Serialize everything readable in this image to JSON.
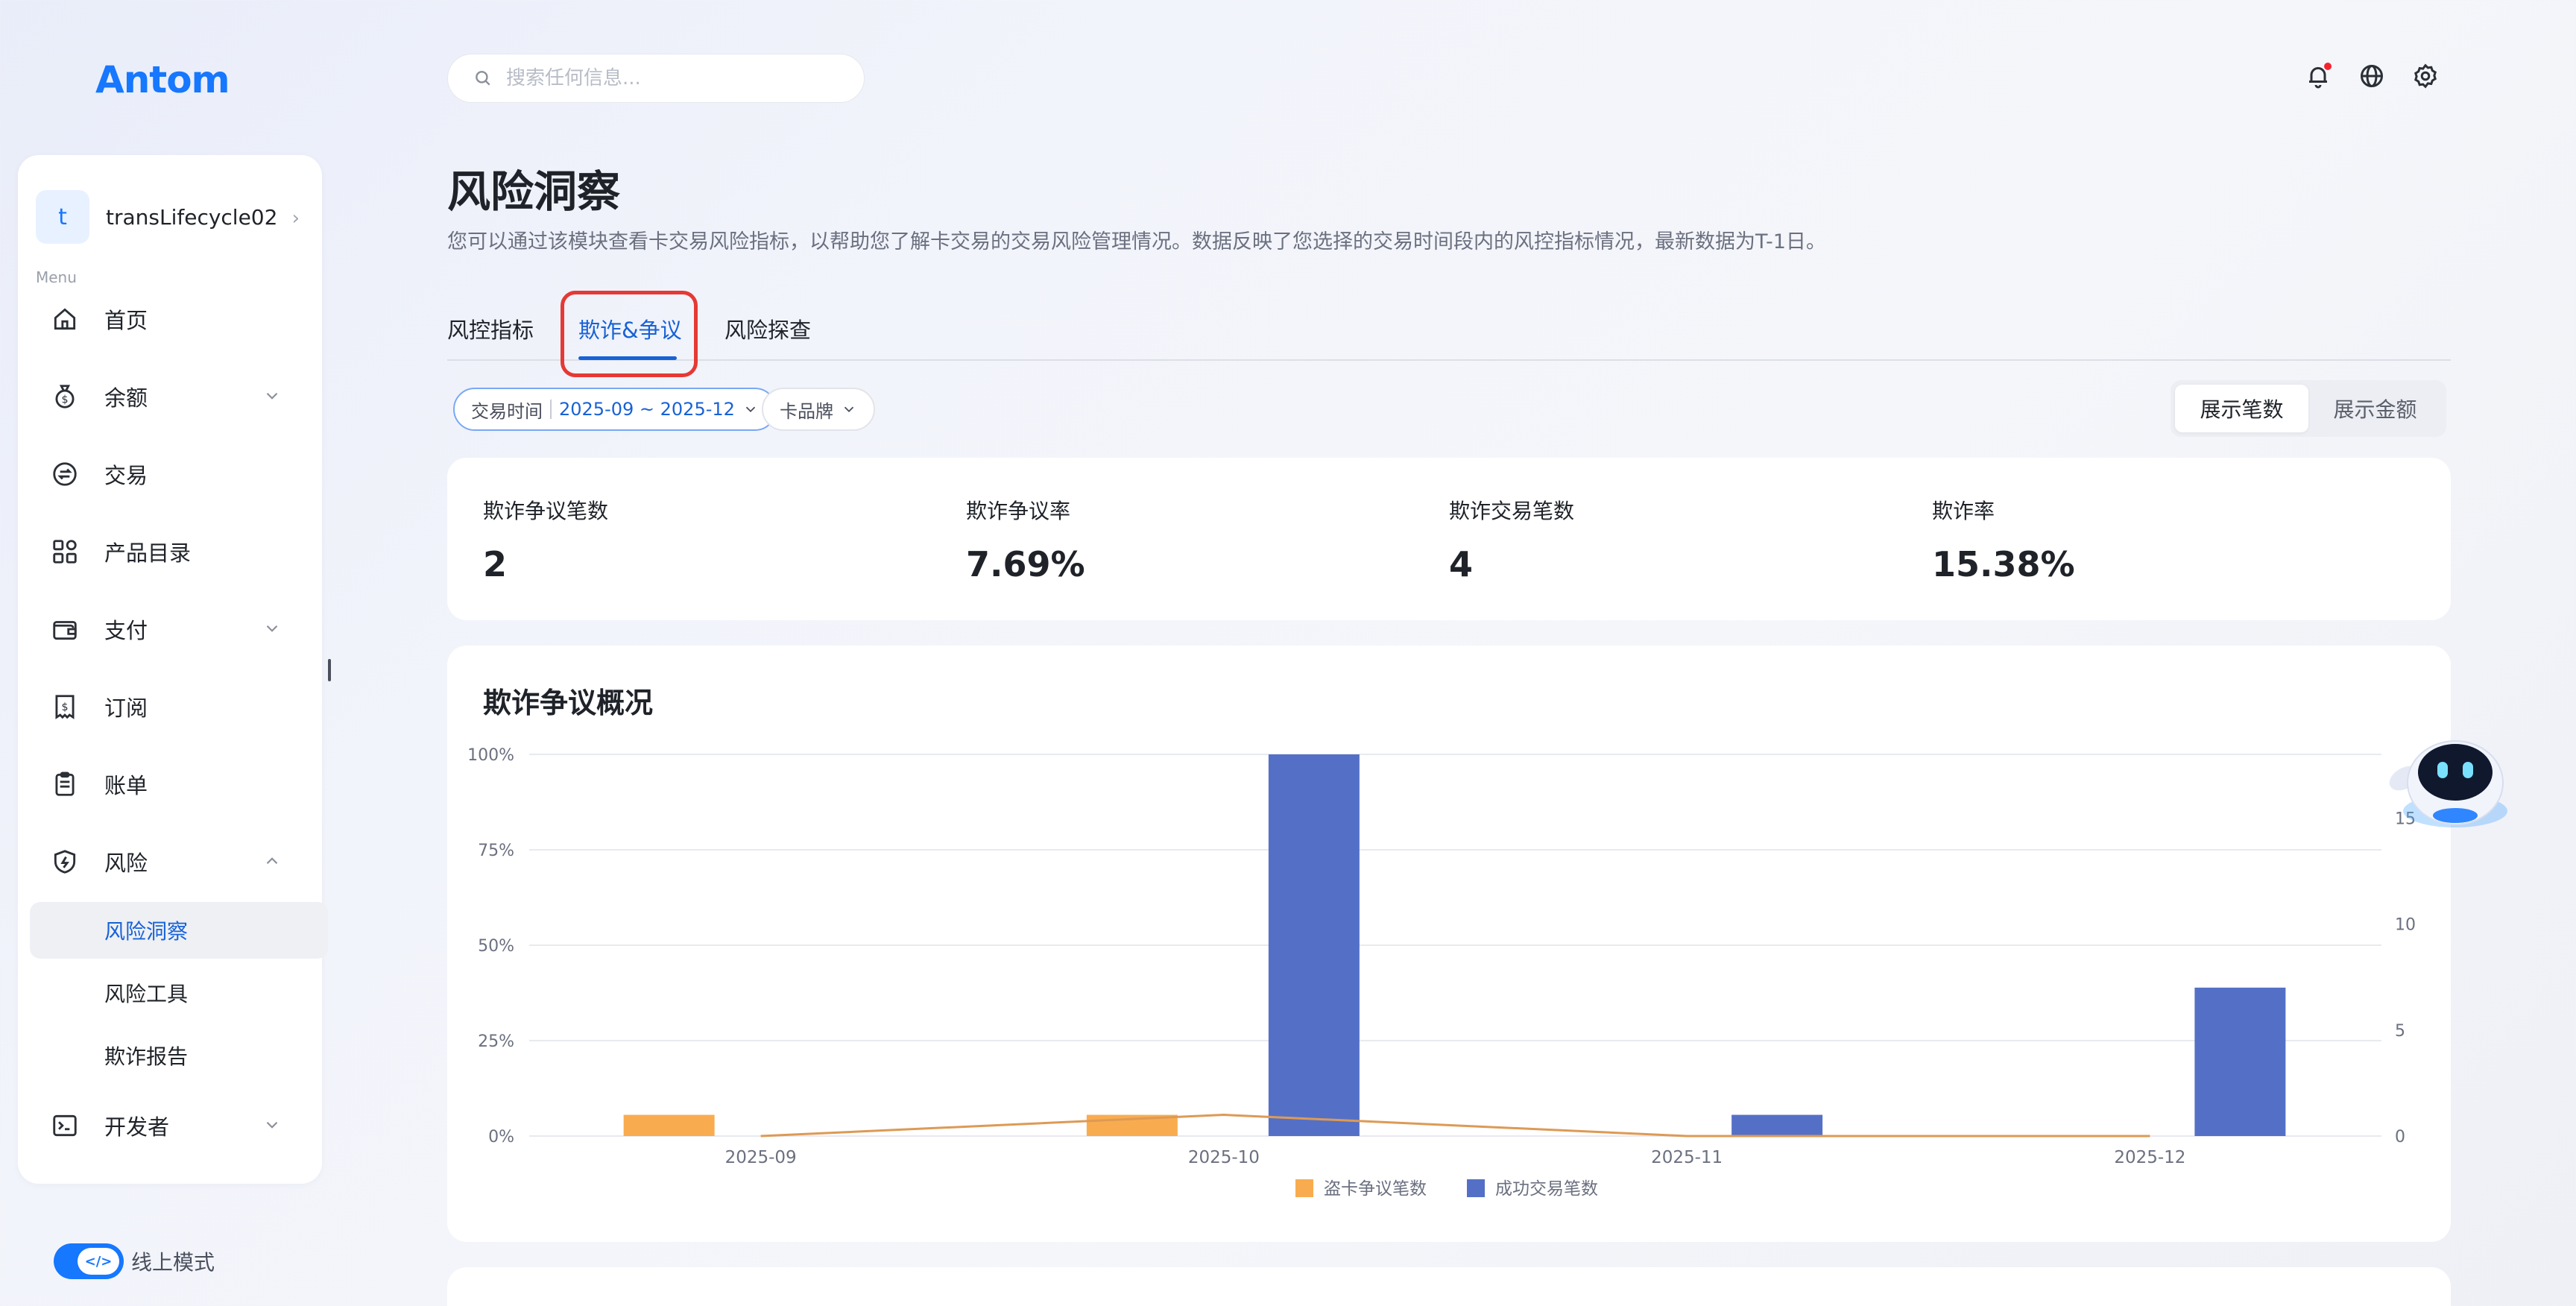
{
  "brand": {
    "logo": "Antom"
  },
  "search": {
    "placeholder": "搜索任何信息..."
  },
  "account": {
    "initial": "t",
    "name": "transLifecycle02"
  },
  "sidebar": {
    "menu_label": "Menu",
    "items": [
      {
        "label": "首页",
        "icon": "home-icon"
      },
      {
        "label": "余额",
        "icon": "money-bag-icon",
        "expandable": true
      },
      {
        "label": "交易",
        "icon": "exchange-icon"
      },
      {
        "label": "产品目录",
        "icon": "grid-icon"
      },
      {
        "label": "支付",
        "icon": "wallet-icon",
        "expandable": true
      },
      {
        "label": "订阅",
        "icon": "receipt-icon"
      },
      {
        "label": "账单",
        "icon": "clipboard-icon"
      },
      {
        "label": "风险",
        "icon": "shield-icon",
        "expandable": true,
        "expanded": true
      },
      {
        "label": "开发者",
        "icon": "terminal-icon",
        "expandable": true
      }
    ],
    "risk_sub": [
      {
        "label": "风险洞察",
        "active": true
      },
      {
        "label": "风险工具"
      },
      {
        "label": "欺诈报告"
      }
    ],
    "online_mode": {
      "label": "线上模式",
      "toggle_icon": "code-icon",
      "on": true
    }
  },
  "page": {
    "title": "风险洞察",
    "description": "您可以通过该模块查看卡交易风险指标，以帮助您了解卡交易的交易风险管理情况。数据反映了您选择的交易时间段内的风控指标情况，最新数据为T-1日。",
    "tabs": [
      {
        "label": "风控指标"
      },
      {
        "label": "欺诈&争议",
        "active": true
      },
      {
        "label": "风险探查"
      }
    ],
    "filters": {
      "time_label": "交易时间",
      "time_value": "2025-09 ~ 2025-12",
      "brand_label": "卡品牌"
    },
    "view_toggle": {
      "count_label": "展示笔数",
      "amount_label": "展示金额",
      "selected": "count"
    },
    "metrics": [
      {
        "label": "欺诈争议笔数",
        "value": "2"
      },
      {
        "label": "欺诈争议率",
        "value": "7.69%"
      },
      {
        "label": "欺诈交易笔数",
        "value": "4"
      },
      {
        "label": "欺诈率",
        "value": "15.38%"
      }
    ]
  },
  "colors": {
    "accent": "#1677ff",
    "bar_dispute": "#f9ac4f",
    "bar_success": "#5470c6",
    "line": "#dd9a55"
  },
  "chart_data": {
    "type": "bar",
    "title": "欺诈争议概况",
    "categories": [
      "2025-09",
      "2025-10",
      "2025-11",
      "2025-12"
    ],
    "left_axis": {
      "ticks": [
        "0%",
        "25%",
        "50%",
        "75%",
        "100%"
      ],
      "ylim": [
        0,
        100
      ]
    },
    "right_axis": {
      "ticks": [
        "0",
        "5",
        "10",
        "15"
      ],
      "ylim": [
        0,
        18
      ]
    },
    "series": [
      {
        "name": "盗卡争议笔数",
        "type": "bar",
        "axis": "right",
        "values": [
          1,
          1,
          0,
          0
        ]
      },
      {
        "name": "成功交易笔数",
        "type": "bar",
        "axis": "right",
        "values": [
          0,
          18,
          1,
          7
        ]
      },
      {
        "type": "line",
        "axis": "left",
        "values": [
          0,
          5.56,
          0,
          0
        ]
      }
    ],
    "legend": "bottom-center",
    "grid": true
  }
}
